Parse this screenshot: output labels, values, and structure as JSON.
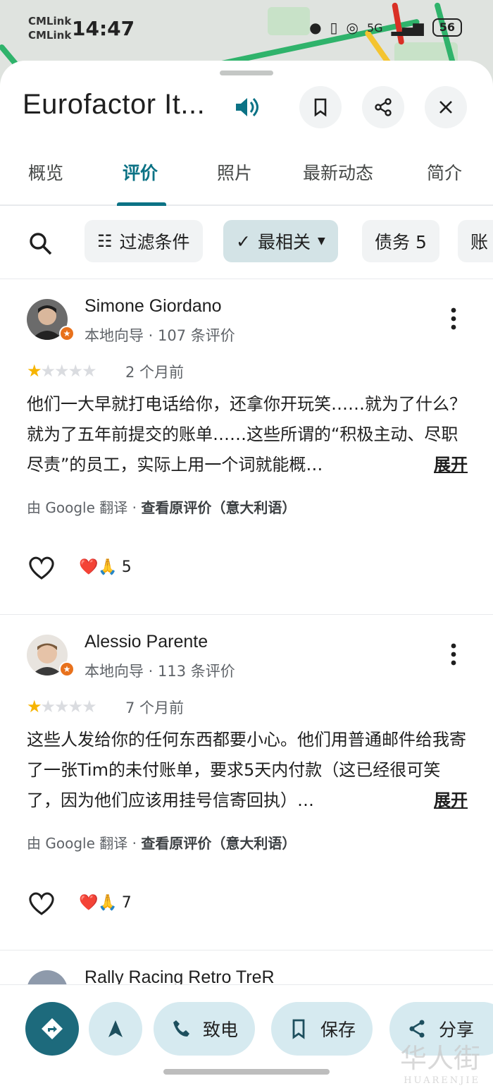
{
  "status_bar": {
    "carrier1": "CMLink",
    "carrier2": "CMLink",
    "time": "14:47",
    "battery": "56",
    "network": "5G"
  },
  "place": {
    "title": "Eurofactor It...",
    "speaker_icon": "speaker-icon",
    "save_icon": "bookmark-icon",
    "share_icon": "share-icon",
    "close_icon": "close-icon"
  },
  "tabs": [
    {
      "label": "概览"
    },
    {
      "label": "评价",
      "active": true
    },
    {
      "label": "照片"
    },
    {
      "label": "最新动态"
    },
    {
      "label": "简介"
    }
  ],
  "chips": {
    "filter": "过滤条件",
    "sort": "最相关",
    "topic1": "债务 5",
    "topic2": "账"
  },
  "reviews": [
    {
      "name": "Simone Giordano",
      "meta": "本地向导 · 107 条评价",
      "rating": 1,
      "date": "2 个月前",
      "text": "他们一大早就打电话给你，还拿你开玩笑……就为了什么？就为了五年前提交的账单……这些所谓的“积极主动、尽职尽责”的员工，实际上用一个词就能概…",
      "expand": "展开",
      "translated_by": "由 Google 翻译 · ",
      "view_original": "查看原评价（意大利语）",
      "reactions": "❤️🙏",
      "reaction_count": "5"
    },
    {
      "name": "Alessio Parente",
      "meta": "本地向导 · 113 条评价",
      "rating": 1,
      "date": "7 个月前",
      "text": "这些人发给你的任何东西都要小心。他们用普通邮件给我寄了一张Tim的未付账单，要求5天内付款（这已经很可笑了，因为他们应该用挂号信寄回执）…",
      "expand": "展开",
      "translated_by": "由 Google 翻译 · ",
      "view_original": "查看原评价（意大利语）",
      "reactions": "❤️🙏",
      "reaction_count": "7"
    },
    {
      "name": "Rally Racing Retro TreR"
    }
  ],
  "actions": {
    "call": "致电",
    "save": "保存",
    "share": "分享"
  },
  "watermark": {
    "text": "华人街",
    "sub": "HUARENJIE"
  },
  "colors": {
    "accent": "#0b7285",
    "star": "#f6b400",
    "badge": "#e8711c",
    "action_bg": "#d6eaf0",
    "directions_bg": "#1d6a7c"
  }
}
